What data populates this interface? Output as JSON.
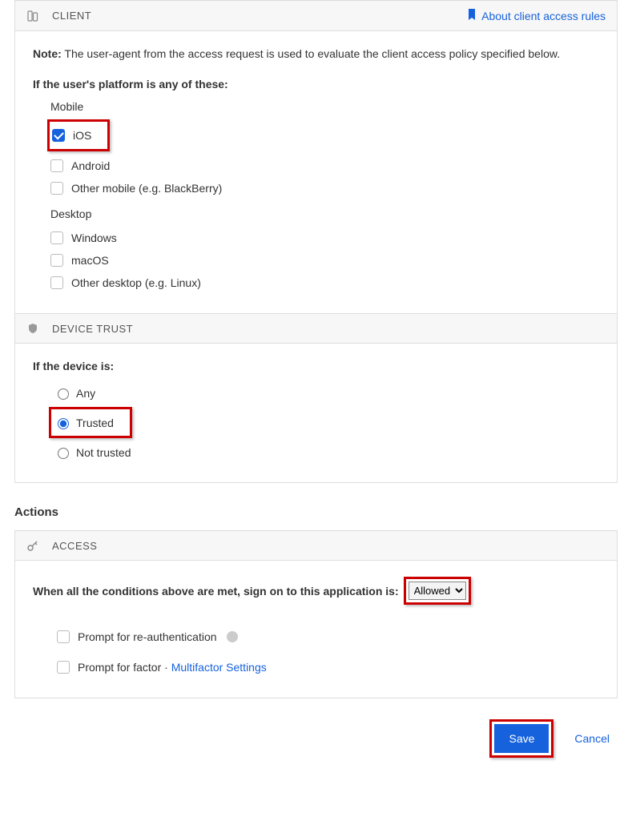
{
  "client": {
    "header_title": "CLIENT",
    "about_link": "About client access rules",
    "note_label": "Note:",
    "note_text": "The user-agent from the access request is used to evaluate the client access policy specified below.",
    "platform_label": "If the user's platform is any of these:",
    "mobile_label": "Mobile",
    "desktop_label": "Desktop",
    "platforms": {
      "ios": "iOS",
      "android": "Android",
      "other_mobile": "Other mobile (e.g. BlackBerry)",
      "windows": "Windows",
      "macos": "macOS",
      "other_desktop": "Other desktop (e.g. Linux)"
    }
  },
  "device_trust": {
    "header_title": "DEVICE TRUST",
    "prompt": "If the device is:",
    "options": {
      "any": "Any",
      "trusted": "Trusted",
      "not_trusted": "Not trusted"
    }
  },
  "actions": {
    "heading": "Actions",
    "access_header": "ACCESS",
    "condition_text": "When all the conditions above are met, sign on to this application is:",
    "select_value": "Allowed",
    "reauth_label": "Prompt for re-authentication",
    "factor_label_prefix": "Prompt for factor · ",
    "mf_link": "Multifactor Settings"
  },
  "footer": {
    "save": "Save",
    "cancel": "Cancel"
  }
}
